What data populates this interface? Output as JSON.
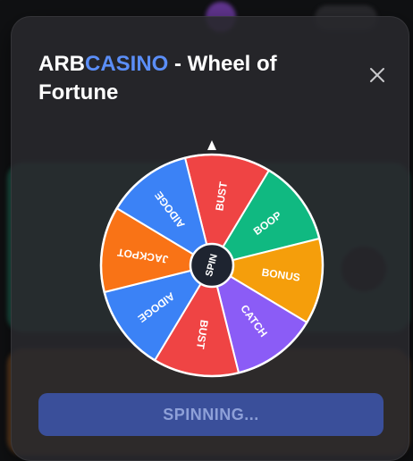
{
  "modal": {
    "title_prefix": "ARB",
    "title_accent": "CASINO",
    "title_suffix": " - Wheel of Fortune",
    "close_icon": "close-icon"
  },
  "wheel": {
    "center_label": "SPIN",
    "pointer_icon": "triangle-pointer-icon",
    "segments": [
      {
        "label": "BUST",
        "color": "#ef4444"
      },
      {
        "label": "BOOP",
        "color": "#10b981"
      },
      {
        "label": "BONUS",
        "color": "#f59e0b"
      },
      {
        "label": "CATCH",
        "color": "#8b5cf6"
      },
      {
        "label": "BUST",
        "color": "#ef4444"
      },
      {
        "label": "AIDOGE",
        "color": "#3b82f6"
      },
      {
        "label": "JACKPOT",
        "color": "#f97316"
      },
      {
        "label": "AIDOGE",
        "color": "#3b82f6"
      }
    ]
  },
  "spin_button": {
    "label": "SPINNING..."
  }
}
